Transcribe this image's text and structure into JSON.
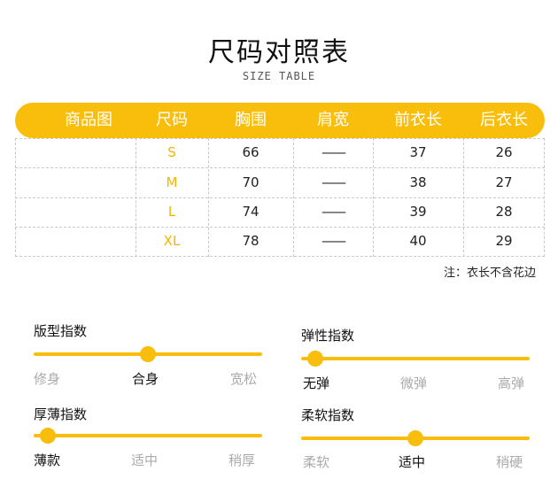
{
  "header": {
    "title": "尺码对照表",
    "subtitle": "SIZE TABLE"
  },
  "table": {
    "columns": [
      "商品图",
      "尺码",
      "胸围",
      "肩宽",
      "前衣长",
      "后衣长"
    ],
    "rows": [
      {
        "size": "S",
        "chest": "66",
        "shoulder": "——",
        "front_length": "37",
        "back_length": "26"
      },
      {
        "size": "M",
        "chest": "70",
        "shoulder": "——",
        "front_length": "38",
        "back_length": "27"
      },
      {
        "size": "L",
        "chest": "74",
        "shoulder": "——",
        "front_length": "39",
        "back_length": "28"
      },
      {
        "size": "XL",
        "chest": "78",
        "shoulder": "——",
        "front_length": "40",
        "back_length": "29"
      }
    ],
    "note": "注：衣长不含花边"
  },
  "indices": [
    {
      "title": "版型指数",
      "options": [
        "修身",
        "合身",
        "宽松"
      ],
      "selected_index": 1
    },
    {
      "title": "弹性指数",
      "options": [
        "无弹",
        "微弹",
        "高弹"
      ],
      "selected_index": 0
    },
    {
      "title": "厚薄指数",
      "options": [
        "薄款",
        "适中",
        "稍厚"
      ],
      "selected_index": 0
    },
    {
      "title": "柔软指数",
      "options": [
        "柔软",
        "适中",
        "稍硬"
      ],
      "selected_index": 1
    }
  ],
  "colors": {
    "accent": "#f9be0c",
    "muted": "#aaaaaa",
    "text": "#111111"
  }
}
